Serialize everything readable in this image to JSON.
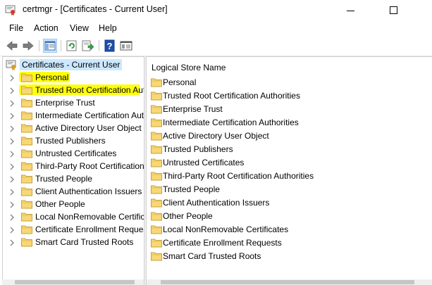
{
  "window": {
    "title": "certmgr - [Certificates - Current User]",
    "minimize_icon": "minimize-icon",
    "maximize_icon": "maximize-icon"
  },
  "menu": [
    "File",
    "Action",
    "View",
    "Help"
  ],
  "toolbar": {
    "icons": [
      "back-arrow-icon",
      "forward-arrow-icon",
      "show-hide-console-tree-icon",
      "refresh-icon",
      "export-list-icon",
      "help-icon",
      "properties-icon"
    ]
  },
  "tree": {
    "root_label": "Certificates - Current User",
    "items": [
      {
        "label": "Personal",
        "highlighted": true
      },
      {
        "label": "Trusted Root Certification Authorities",
        "highlighted": true
      },
      {
        "label": "Enterprise Trust",
        "highlighted": false
      },
      {
        "label": "Intermediate Certification Authorities",
        "highlighted": false
      },
      {
        "label": "Active Directory User Object",
        "highlighted": false
      },
      {
        "label": "Trusted Publishers",
        "highlighted": false
      },
      {
        "label": "Untrusted Certificates",
        "highlighted": false
      },
      {
        "label": "Third-Party Root Certification Authorities",
        "highlighted": false
      },
      {
        "label": "Trusted People",
        "highlighted": false
      },
      {
        "label": "Client Authentication Issuers",
        "highlighted": false
      },
      {
        "label": "Other People",
        "highlighted": false
      },
      {
        "label": "Local NonRemovable Certificates",
        "highlighted": false
      },
      {
        "label": "Certificate Enrollment Requests",
        "highlighted": false
      },
      {
        "label": "Smart Card Trusted Roots",
        "highlighted": false
      }
    ]
  },
  "list": {
    "column_header": "Logical Store Name",
    "items": [
      "Personal",
      "Trusted Root Certification Authorities",
      "Enterprise Trust",
      "Intermediate Certification Authorities",
      "Active Directory User Object",
      "Trusted Publishers",
      "Untrusted Certificates",
      "Third-Party Root Certification Authorities",
      "Trusted People",
      "Client Authentication Issuers",
      "Other People",
      "Local NonRemovable Certificates",
      "Certificate Enrollment Requests",
      "Smart Card Trusted Roots"
    ]
  },
  "colors": {
    "highlight": "#ffff00",
    "selection": "#cce8ff",
    "folder": "#f8d775"
  }
}
